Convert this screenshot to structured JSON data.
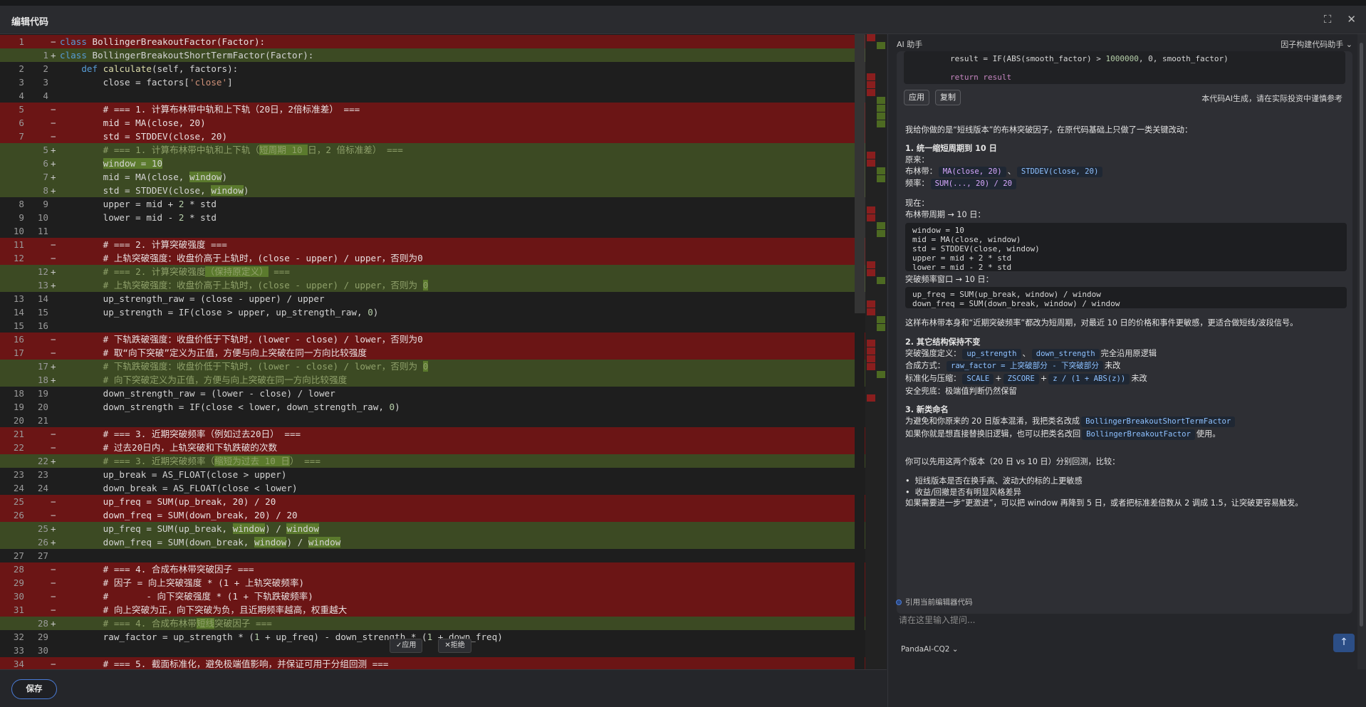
{
  "header": {
    "title": "编辑代码"
  },
  "editor": {
    "lines": [
      {
        "t": "del",
        "lo": "1",
        "ln": "",
        "mk": "−",
        "h": "<span class=\"kw\">class</span> BollingerBreakoutFactor(Factor):"
      },
      {
        "t": "add",
        "lo": "",
        "ln": "1",
        "mk": "+",
        "h": "<span class=\"kw\">class</span> BollingerBreakoutShortTermFactor(Factor):"
      },
      {
        "t": "",
        "lo": "2",
        "ln": "2",
        "mk": "",
        "h": "    <span class=\"kw\">def</span> <span class=\"fn\">calculate</span>(self, factors):"
      },
      {
        "t": "",
        "lo": "3",
        "ln": "3",
        "mk": "",
        "h": "        close = factors[<span class=\"str\">'close'</span>]"
      },
      {
        "t": "",
        "lo": "4",
        "ln": "4",
        "mk": "",
        "h": ""
      },
      {
        "t": "del",
        "lo": "5",
        "ln": "",
        "mk": "−",
        "h": "        # === 1. 计算布林带中轨和上下轨（20日，2倍标准差） ==="
      },
      {
        "t": "del",
        "lo": "6",
        "ln": "",
        "mk": "−",
        "h": "        mid = MA(close, 20)"
      },
      {
        "t": "del",
        "lo": "7",
        "ln": "",
        "mk": "−",
        "h": "        std = STDDEV(close, 20)"
      },
      {
        "t": "add",
        "lo": "",
        "ln": "5",
        "mk": "+",
        "h": "        <span class=\"cm\"># === 1. 计算布林带中轨和上下轨（<span class=\"hl\">短周期 10 </span>日，2 倍标准差） ===</span>"
      },
      {
        "t": "add",
        "lo": "",
        "ln": "6",
        "mk": "+",
        "h": "        <span class=\"hl\">window = 10</span>"
      },
      {
        "t": "add",
        "lo": "",
        "ln": "7",
        "mk": "+",
        "h": "        mid = MA(close, <span class=\"hl\">window</span>)"
      },
      {
        "t": "add",
        "lo": "",
        "ln": "8",
        "mk": "+",
        "h": "        std = STDDEV(close, <span class=\"hl\">window</span>)"
      },
      {
        "t": "",
        "lo": "8",
        "ln": "9",
        "mk": "",
        "h": "        upper = mid + <span class=\"num\">2</span> * std"
      },
      {
        "t": "",
        "lo": "9",
        "ln": "10",
        "mk": "",
        "h": "        lower = mid - <span class=\"num\">2</span> * std"
      },
      {
        "t": "",
        "lo": "10",
        "ln": "11",
        "mk": "",
        "h": ""
      },
      {
        "t": "del",
        "lo": "11",
        "ln": "",
        "mk": "−",
        "h": "        # === 2. 计算突破强度 ==="
      },
      {
        "t": "del",
        "lo": "12",
        "ln": "",
        "mk": "−",
        "h": "        # 上轨突破强度：收盘价高于上轨时，(close - upper) / upper，否则为0"
      },
      {
        "t": "add",
        "lo": "",
        "ln": "12",
        "mk": "+",
        "h": "        <span class=\"cm\"># === 2. 计算突破强度<span class=\"hl\">（保持原定义）</span> ===</span>"
      },
      {
        "t": "add",
        "lo": "",
        "ln": "13",
        "mk": "+",
        "h": "        <span class=\"cm\"># 上轨突破强度：收盘价高于上轨时，(close - upper) / upper，否则为 <span class=\"hl\">0</span></span>"
      },
      {
        "t": "",
        "lo": "13",
        "ln": "14",
        "mk": "",
        "h": "        up_strength_raw = (close - upper) / upper"
      },
      {
        "t": "",
        "lo": "14",
        "ln": "15",
        "mk": "",
        "h": "        up_strength = IF(close > upper, up_strength_raw, <span class=\"num\">0</span>)"
      },
      {
        "t": "",
        "lo": "15",
        "ln": "16",
        "mk": "",
        "h": ""
      },
      {
        "t": "del",
        "lo": "16",
        "ln": "",
        "mk": "−",
        "h": "        # 下轨跌破强度：收盘价低于下轨时，(lower - close) / lower，否则为0"
      },
      {
        "t": "del",
        "lo": "17",
        "ln": "",
        "mk": "−",
        "h": "        # 取“向下突破”定义为正值，方便与向上突破在同一方向比较强度"
      },
      {
        "t": "add",
        "lo": "",
        "ln": "17",
        "mk": "+",
        "h": "        <span class=\"cm\"># 下轨跌破强度：收盘价低于下轨时，(lower - close) / lower，否则为 <span class=\"hl\">0</span></span>"
      },
      {
        "t": "add",
        "lo": "",
        "ln": "18",
        "mk": "+",
        "h": "        <span class=\"cm\"># 向下突破定义为正值，方便与向上突破在同一方向比较强度</span>"
      },
      {
        "t": "",
        "lo": "18",
        "ln": "19",
        "mk": "",
        "h": "        down_strength_raw = (lower - close) / lower"
      },
      {
        "t": "",
        "lo": "19",
        "ln": "20",
        "mk": "",
        "h": "        down_strength = IF(close < lower, down_strength_raw, <span class=\"num\">0</span>)"
      },
      {
        "t": "",
        "lo": "20",
        "ln": "21",
        "mk": "",
        "h": ""
      },
      {
        "t": "del",
        "lo": "21",
        "ln": "",
        "mk": "−",
        "h": "        # === 3. 近期突破频率（例如过去20日） ==="
      },
      {
        "t": "del",
        "lo": "22",
        "ln": "",
        "mk": "−",
        "h": "        # 过去20日内，上轨突破和下轨跌破的次数"
      },
      {
        "t": "add",
        "lo": "",
        "ln": "22",
        "mk": "+",
        "h": "        <span class=\"cm\"># === 3. 近期突破频率（<span class=\"hl\">缩短为过去 10 日</span>） ===</span>"
      },
      {
        "t": "",
        "lo": "23",
        "ln": "23",
        "mk": "",
        "h": "        up_break = AS_FLOAT(close > upper)"
      },
      {
        "t": "",
        "lo": "24",
        "ln": "24",
        "mk": "",
        "h": "        down_break = AS_FLOAT(close < lower)"
      },
      {
        "t": "del",
        "lo": "25",
        "ln": "",
        "mk": "−",
        "h": "        up_freq = SUM(up_break, 20) / 20"
      },
      {
        "t": "del",
        "lo": "26",
        "ln": "",
        "mk": "−",
        "h": "        down_freq = SUM(down_break, 20) / 20"
      },
      {
        "t": "add",
        "lo": "",
        "ln": "25",
        "mk": "+",
        "h": "        up_freq = SUM(up_break, <span class=\"hl\">window</span>) / <span class=\"hl\">window</span>"
      },
      {
        "t": "add",
        "lo": "",
        "ln": "26",
        "mk": "+",
        "h": "        down_freq = SUM(down_break, <span class=\"hl\">window</span>) / <span class=\"hl\">window</span>"
      },
      {
        "t": "",
        "lo": "27",
        "ln": "27",
        "mk": "",
        "h": ""
      },
      {
        "t": "del",
        "lo": "28",
        "ln": "",
        "mk": "−",
        "h": "        # === 4. 合成布林带突破因子 ==="
      },
      {
        "t": "del",
        "lo": "29",
        "ln": "",
        "mk": "−",
        "h": "        # 因子 = 向上突破强度 * (1 + 上轨突破频率)"
      },
      {
        "t": "del",
        "lo": "30",
        "ln": "",
        "mk": "−",
        "h": "        #       - 向下突破强度 * (1 + 下轨跌破频率)"
      },
      {
        "t": "del",
        "lo": "31",
        "ln": "",
        "mk": "−",
        "h": "        # 向上突破为正，向下突破为负，且近期频率越高，权重越大"
      },
      {
        "t": "add",
        "lo": "",
        "ln": "28",
        "mk": "+",
        "h": "        <span class=\"cm\"># === 4. 合成布林带<span class=\"hl\">短线</span>突破因子 ===</span>"
      },
      {
        "t": "",
        "lo": "32",
        "ln": "29",
        "mk": "",
        "h": "        raw_factor = up_strength * (<span class=\"num\">1</span> + up_freq) - down_strength * (<span class=\"num\">1</span> + down_freq)"
      },
      {
        "t": "",
        "lo": "33",
        "ln": "30",
        "mk": "",
        "h": ""
      },
      {
        "t": "del",
        "lo": "34",
        "ln": "",
        "mk": "−",
        "h": "        # === 5. 截面标准化，避免极端值影响，并保证可用于分组回测 ==="
      }
    ],
    "inline_accept": "✓应用",
    "inline_reject": "✕拒绝"
  },
  "footer": {
    "save_label": "保存"
  },
  "ai": {
    "title": "AI 助手",
    "mode": "因子构建代码助手 ⌄",
    "code_line1_pre": "        result = IF(ABS(smooth_factor) > ",
    "code_line1_num": "1000000",
    "code_line1_post": ", 0, smooth_factor)",
    "code_line2": "        return result",
    "apply": "应用",
    "copy": "复制",
    "disclaimer": "本代码AI生成，请在实际投资中谨慎参考",
    "intro": "我给你做的是“短线版本”的布林突破因子，在原代码基础上只做了一类关键改动：",
    "s1_title": "1. 统一缩短周期到 10 日",
    "s1_orig": "原来：",
    "s1_boll_label": "布林带：",
    "s1_boll_chip1": "MA(close, 20)",
    "s1_boll_sep": "、",
    "s1_boll_chip2": "STDDEV(close, 20)",
    "s1_freq_label": "频率：",
    "s1_freq_chip": "SUM(..., 20) / 20",
    "s1_now": "现在：",
    "s1_now_boll": "布林带周期 → 10 日：",
    "snip1": [
      "window = 10",
      "mid = MA(close, window)",
      "std = STDDEV(close, window)",
      "upper = mid + 2 * std",
      "lower = mid - 2 * std"
    ],
    "s1_freq_now": "突破频率窗口 → 10 日：",
    "snip2": [
      "up_freq = SUM(up_break, window) / window",
      "down_freq = SUM(down_break, window) / window"
    ],
    "s1_summary": "这样布林带本身和“近期突破频率”都改为短周期，对最近 10 日的价格和事件更敏感，更适合做短线/波段信号。",
    "s2_title": "2. 其它结构保持不变",
    "s2_def_label": "突破强度定义：",
    "s2_def_chip1": "up_strength",
    "s2_def_chip2": "down_strength",
    "s2_def_tail": "完全沿用原逻辑",
    "s2_comb_label": "合成方式：",
    "s2_comb_chip": "raw_factor = 上突破部分 - 下突破部分",
    "s2_comb_tail": "未改",
    "s2_norm_label": "标准化与压缩：",
    "s2_norm_chip1": "SCALE",
    "s2_norm_chip2": "ZSCORE",
    "s2_norm_chip3": "z / (1 + ABS(z))",
    "s2_norm_tail": "未改",
    "s2_safe": "安全兜底：极端值判断仍然保留",
    "s3_title": "3. 新类命名",
    "s3_l1_pre": "为避免和你原来的 20 日版本混淆，我把类名改成",
    "s3_l1_chip": "BollingerBreakoutShortTermFactor",
    "s3_l2_pre": "如果你就是想直接替换旧逻辑，也可以把类名改回",
    "s3_l2_chip": "BollingerBreakoutFactor",
    "s3_l2_tail": "使用。",
    "compare": "你可以先用这两个版本（20 日 vs 10 日）分别回测，比较：",
    "b1": "短线版本是否在换手高、波动大的标的上更敏感",
    "b2": "收益/回撤是否有明显风格差异",
    "last": "如果需要进一步“更激进”，可以把 window 再降到 5 日，或者把标准差倍数从 2 调成 1.5，让突破更容易触发。",
    "ref_label": "引用当前编辑器代码",
    "input_placeholder": "请在这里输入提问...",
    "model": "PandaAI-CQ2 ⌄"
  }
}
